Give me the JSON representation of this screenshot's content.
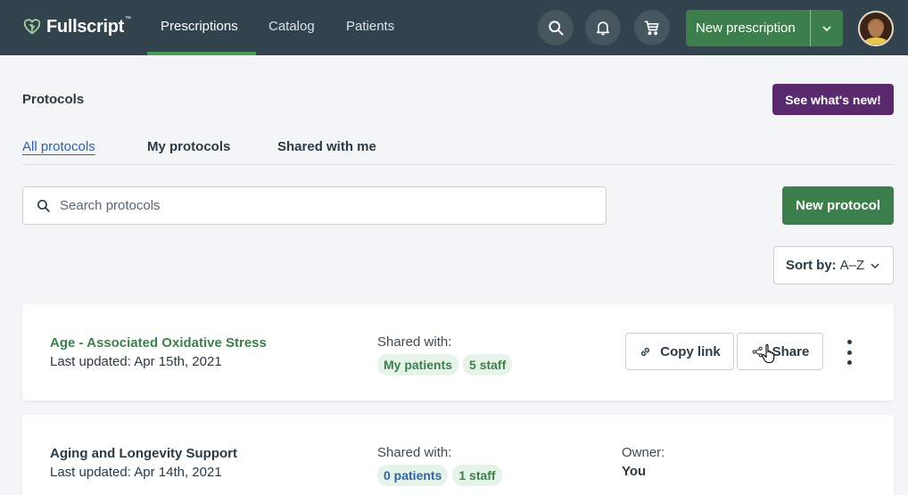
{
  "brand": {
    "name": "Fullscript",
    "tm": "™",
    "accent": "#3d7f4c",
    "nav_bg": "#33434e"
  },
  "nav": {
    "links": [
      "Prescriptions",
      "Catalog",
      "Patients"
    ],
    "active": "Prescriptions",
    "search_icon": "search-icon",
    "notifications_icon": "bell-icon",
    "cart_icon": "cart-icon",
    "new_prescription_label": "New prescription"
  },
  "page": {
    "title": "Protocols",
    "whats_new_label": "See what's new!",
    "tabs": [
      "All protocols",
      "My protocols",
      "Shared with me"
    ],
    "active_tab": "All protocols",
    "search_placeholder": "Search protocols",
    "new_protocol_label": "New protocol",
    "sort": {
      "label": "Sort by:",
      "value": "A–Z"
    }
  },
  "protocols": [
    {
      "name": "Age - Associated Oxidative Stress",
      "updated": "Last updated: Apr 15th, 2021",
      "shared_label": "Shared with:",
      "patients_badge": "My patients",
      "staff_badge": "5 staff",
      "actions": {
        "copy_link": "Copy link",
        "share": "Share"
      }
    },
    {
      "name": "Aging and Longevity Support",
      "updated": "Last updated: Apr 14th, 2021",
      "shared_label": "Shared with:",
      "patients_badge": "0 patients",
      "staff_badge": "1 staff",
      "owner_label": "Owner:",
      "owner_value": "You"
    }
  ]
}
